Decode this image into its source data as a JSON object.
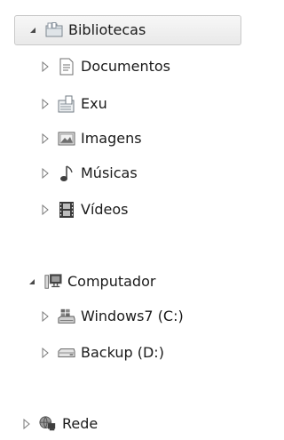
{
  "tree": {
    "libraries": {
      "label": "Bibliotecas",
      "icon": "libraries-folder-icon",
      "expanded": true,
      "children": [
        {
          "label": "Documentos",
          "icon": "document-icon"
        },
        {
          "label": "Exu",
          "icon": "library-icon"
        },
        {
          "label": "Imagens",
          "icon": "picture-icon"
        },
        {
          "label": "Músicas",
          "icon": "music-note-icon"
        },
        {
          "label": "Vídeos",
          "icon": "film-icon"
        }
      ]
    },
    "computer": {
      "label": "Computador",
      "icon": "computer-icon",
      "expanded": true,
      "children": [
        {
          "label": "Windows7 (C:)",
          "icon": "system-drive-icon"
        },
        {
          "label": "Backup (D:)",
          "icon": "hard-drive-icon"
        }
      ]
    },
    "network": {
      "label": "Rede",
      "icon": "network-icon",
      "expanded": false
    }
  },
  "colors": {
    "selection_bg": "#ececec",
    "selection_border": "#c9c9c9",
    "arrow": "#7a7a7a"
  }
}
